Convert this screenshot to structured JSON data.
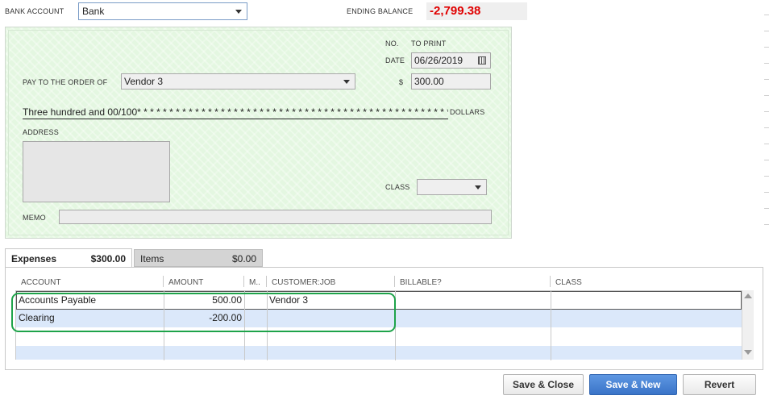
{
  "header": {
    "bank_account_label": "BANK ACCOUNT",
    "bank_account_value": "Bank",
    "ending_balance_label": "ENDING BALANCE",
    "ending_balance_value": "-2,799.38"
  },
  "check": {
    "no_label": "NO.",
    "no_value": "TO PRINT",
    "date_label": "DATE",
    "date_value": "06/26/2019",
    "pay_to_label": "PAY TO THE ORDER OF",
    "payee_value": "Vendor 3",
    "amount_symbol": "$",
    "amount_value": "300.00",
    "amount_words": "Three hundred and 00/100* * * * * * * * * * * * * * * * * * * * * * * * * * * * * * * * * * * * * * * * * * * * * * * * * *",
    "dollars_label": "DOLLARS",
    "address_label": "ADDRESS",
    "class_label": "CLASS",
    "class_value": "",
    "memo_label": "MEMO",
    "memo_value": ""
  },
  "tabs": [
    {
      "label": "Expenses",
      "amount": "$300.00",
      "active": true
    },
    {
      "label": "Items",
      "amount": "$0.00",
      "active": false
    }
  ],
  "grid": {
    "columns": [
      "ACCOUNT",
      "AMOUNT",
      "M..",
      "CUSTOMER:JOB",
      "BILLABLE?",
      "CLASS"
    ],
    "rows": [
      {
        "account": "Accounts Payable",
        "amount": "500.00",
        "memo": "",
        "customer_job": "Vendor 3",
        "billable": "",
        "class": ""
      },
      {
        "account": "Clearing",
        "amount": "-200.00",
        "memo": "",
        "customer_job": "",
        "billable": "",
        "class": ""
      }
    ]
  },
  "buttons": {
    "save_close": "Save & Close",
    "save_new": "Save & New",
    "revert": "Revert"
  },
  "colors": {
    "negative_balance": "#e00000",
    "check_background": "#e4f7e1",
    "row_highlight": "#dbe8fa",
    "annotation_ring": "#1ea34a",
    "primary_button": "#3a74c8"
  },
  "icons": [
    "dropdown-arrow-icon",
    "calendar-icon",
    "scroll-up-icon",
    "scroll-down-icon"
  ]
}
